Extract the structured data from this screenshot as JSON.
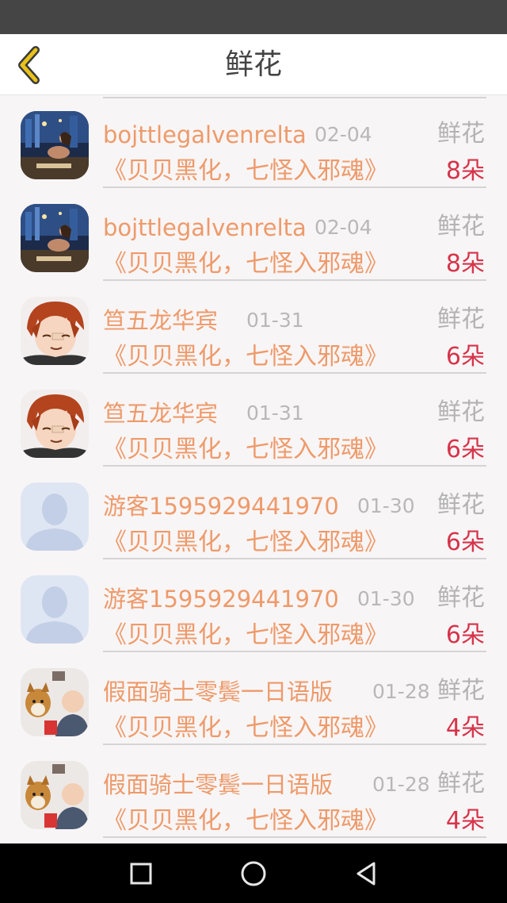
{
  "header": {
    "title": "鲜花"
  },
  "icons": {
    "back": "chevron-left-icon",
    "nav_recent": "square-icon",
    "nav_home": "circle-icon",
    "nav_back": "triangle-back-icon"
  },
  "colors": {
    "accent_name": "#ee9a6a",
    "count_red": "#d6344a",
    "back_yellow": "#e8c21a"
  },
  "rows": [
    {
      "name": "bojttlegalvenrelta",
      "date": "02-04",
      "gift": "鲜花",
      "book": "《贝贝黑化，七怪入邪魂》",
      "count": "8朵",
      "avatar": "night-photo"
    },
    {
      "name": "bojttlegalvenrelta",
      "date": "02-04",
      "gift": "鲜花",
      "book": "《贝贝黑化，七怪入邪魂》",
      "count": "8朵",
      "avatar": "night-photo"
    },
    {
      "name": "笪五龙华宾",
      "date": "01-31",
      "gift": "鲜花",
      "book": "《贝贝黑化，七怪入邪魂》",
      "count": "6朵",
      "avatar": "anime-boy"
    },
    {
      "name": "笪五龙华宾",
      "date": "01-31",
      "gift": "鲜花",
      "book": "《贝贝黑化，七怪入邪魂》",
      "count": "6朵",
      "avatar": "anime-boy"
    },
    {
      "name": "游客1595929441970",
      "date": "01-30",
      "gift": "鲜花",
      "book": "《贝贝黑化，七怪入邪魂》",
      "count": "6朵",
      "avatar": "default-user"
    },
    {
      "name": "游客1595929441970",
      "date": "01-30",
      "gift": "鲜花",
      "book": "《贝贝黑化，七怪入邪魂》",
      "count": "6朵",
      "avatar": "default-user"
    },
    {
      "name": "假面骑士零鬓一日语版",
      "date": "01-28",
      "gift": "鲜花",
      "book": "《贝贝黑化，七怪入邪魂》",
      "count": "4朵",
      "avatar": "baby-dog"
    },
    {
      "name": "假面骑士零鬓一日语版",
      "date": "01-28",
      "gift": "鲜花",
      "book": "《贝贝黑化，七怪入邪魂》",
      "count": "4朵",
      "avatar": "baby-dog"
    }
  ]
}
